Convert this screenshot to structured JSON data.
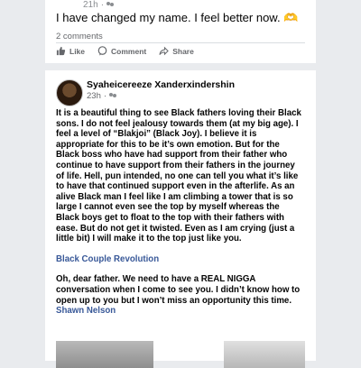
{
  "post1": {
    "time": "21h",
    "text": "I have changed my name. I feel better now. 🫶",
    "comments": "2 comments",
    "actions": {
      "like": "Like",
      "comment": "Comment",
      "share": "Share"
    }
  },
  "post2": {
    "author": "Syaheicereeze Xanderxindershin",
    "time": "23h",
    "paragraph1": "It is a beautiful thing to see Black fathers loving their Black sons. I do not feel jealousy towards them (at my big age). I feel a level of “Blakjoi” (Black Joy). I believe it is appropriate for this to be it’s own emotion. But for the Black boss who have had support from their father who continue to have support from their fathers in the journey of life. Hell, pun intended, no one can tell you what it’s like to have that continued support even in the afterlife. As an alive Black man I feel like I am climbing a tower that is so large I cannot even see the top by myself whereas the Black boys get to float to the top with their fathers with ease. But do not get it twisted. Even as I am crying (just a little bit) I will make it to the top just like you.",
    "tag_link": "Black Couple Revolution",
    "paragraph2": "Oh, dear father. We need to have a REAL NIGGA conversation when I come to see you. I didn’t know how to open up to you but I won’t miss an opportunity this time.",
    "mention": "Shawn Nelson"
  }
}
